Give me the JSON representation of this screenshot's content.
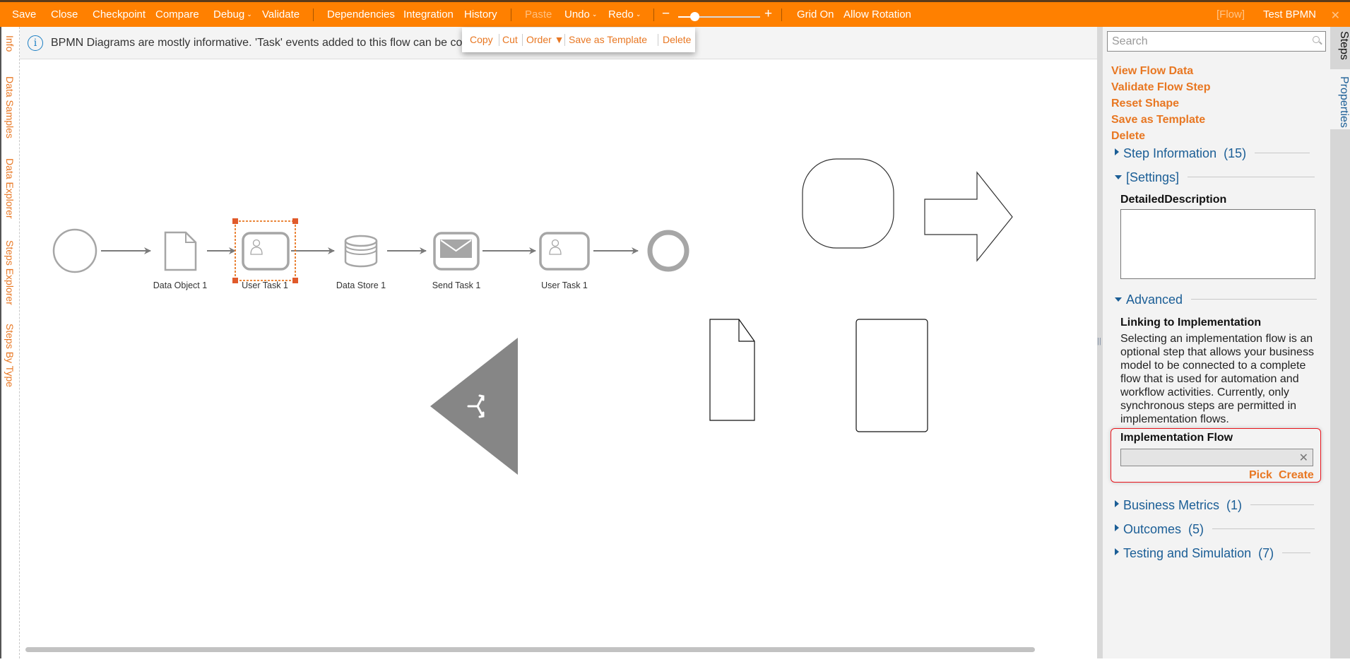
{
  "toolbar": {
    "save": "Save",
    "close": "Close",
    "checkpoint": "Checkpoint",
    "compare": "Compare",
    "debug": "Debug",
    "validate": "Validate",
    "dependencies": "Dependencies",
    "integration": "Integration",
    "history": "History",
    "paste": "Paste",
    "undo": "Undo",
    "redo": "Redo",
    "zoom_minus": "−",
    "zoom_plus": "+",
    "zoom_level_fraction": 0.2,
    "grid_on": "Grid On",
    "allow_rotation": "Allow Rotation",
    "flow_tag": "[Flow]",
    "flow_name": "Test BPMN",
    "close_icon": "✕"
  },
  "left_tabs": [
    "Info",
    "Data Samples",
    "Data Explorer",
    "Steps Explorer",
    "Steps By Type"
  ],
  "info_bar": {
    "icon": "i",
    "message": "BPMN Diagrams are mostly informative. 'Task' events added to this flow can be connected to implementation flows."
  },
  "context_popup": {
    "copy": "Copy",
    "cut": "Cut",
    "order": "Order ▼",
    "save_as_template": "Save as Template",
    "delete": "Delete"
  },
  "diagram": {
    "nodes": [
      {
        "id": "start",
        "type": "start-event",
        "label": ""
      },
      {
        "id": "dataobj",
        "type": "data-object",
        "label": "Data Object 1"
      },
      {
        "id": "usertask1",
        "type": "user-task",
        "label": "User Task 1",
        "selected": true
      },
      {
        "id": "datastore",
        "type": "data-store",
        "label": "Data Store 1"
      },
      {
        "id": "sendtask",
        "type": "send-task",
        "label": "Send Task 1"
      },
      {
        "id": "usertask2",
        "type": "user-task",
        "label": "User Task 1"
      },
      {
        "id": "end",
        "type": "end-event",
        "label": ""
      }
    ],
    "colors": {
      "shape_stroke": "#a6a6a6",
      "selection": "#e87722",
      "handle": "#e05a2b",
      "triangle_fill": "#868686"
    }
  },
  "panel": {
    "search_placeholder": "Search",
    "actions": [
      "View Flow Data",
      "Validate Flow Step",
      "Reset Shape",
      "Save as Template",
      "Delete"
    ],
    "sections": {
      "step_information": {
        "label": "Step Information",
        "count": "(15)"
      },
      "settings": {
        "label": "[Settings]"
      },
      "advanced": {
        "label": "Advanced"
      },
      "business_metrics": {
        "label": "Business Metrics",
        "count": "(1)"
      },
      "outcomes": {
        "label": "Outcomes",
        "count": "(5)"
      },
      "testing": {
        "label": "Testing and Simulation",
        "count": "(7)"
      }
    },
    "detailed_description_label": "DetailedDescription",
    "detailed_description_value": "",
    "linking_title": "Linking to Implementation",
    "linking_text": "Selecting an implementation flow is an optional step that allows your business model to be connected to a complete flow that is used for automation and workflow activities. Currently, only synchronous steps are permitted in implementation flows.",
    "implementation_flow_label": "Implementation Flow",
    "implementation_flow_value": "",
    "clear_icon": "✕",
    "pick": "Pick",
    "create": "Create"
  },
  "right_tabs": {
    "steps": "Steps",
    "properties": "Properties"
  },
  "splitter_grip": "||"
}
